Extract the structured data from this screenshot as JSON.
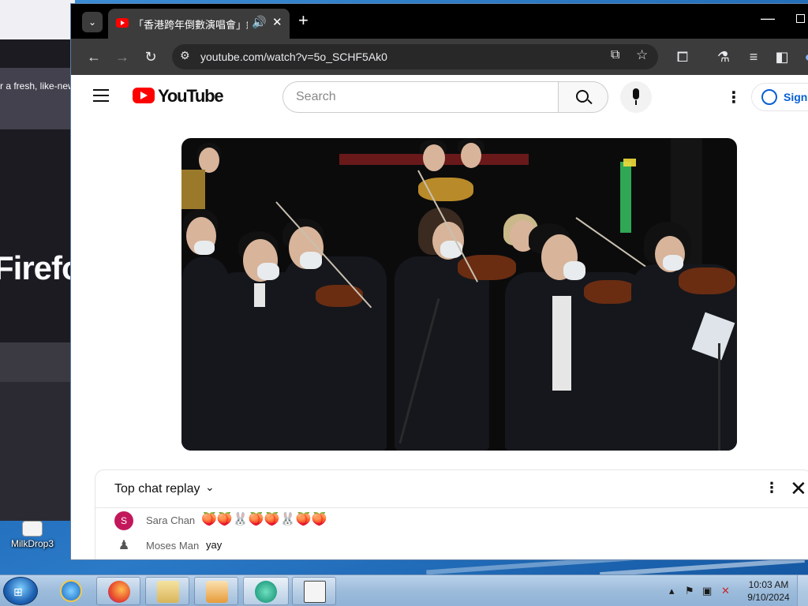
{
  "background_window": {
    "banner_text": "r a fresh, like-new",
    "logo_text": "Firefo"
  },
  "desktop": {
    "icon_label": "MilkDrop3"
  },
  "chrome": {
    "tab_title": "「香港跨年倒數演唱會」線上",
    "url": "youtube.com/watch?v=5o_SCHF5Ak0",
    "new_tab_glyph": "+",
    "tab_close_glyph": "✕",
    "audio_glyph": "🔊"
  },
  "youtube": {
    "wordmark": "YouTube",
    "search_placeholder": "Search",
    "sign_in": "Sign",
    "chat": {
      "title": "Top chat replay",
      "messages": [
        {
          "author": "Sara Chan",
          "avatar_letter": "S",
          "avatar_color": "#c2185b",
          "text": "🍑🍑🐰🍑🍑🐰🍑🍑"
        },
        {
          "author": "Moses Man",
          "avatar_letter": "",
          "avatar_color": "#777777",
          "text": "yay"
        }
      ]
    }
  },
  "taskbar": {
    "time": "10:03 AM",
    "date": "9/10/2024",
    "pinned": [
      "internet-explorer",
      "firefox",
      "file-explorer",
      "media-player",
      "app-green",
      "app-calendar"
    ]
  },
  "colors": {
    "youtube_red": "#ff0000",
    "link_blue": "#065fd4",
    "chrome_dark": "#3c3c3c"
  }
}
